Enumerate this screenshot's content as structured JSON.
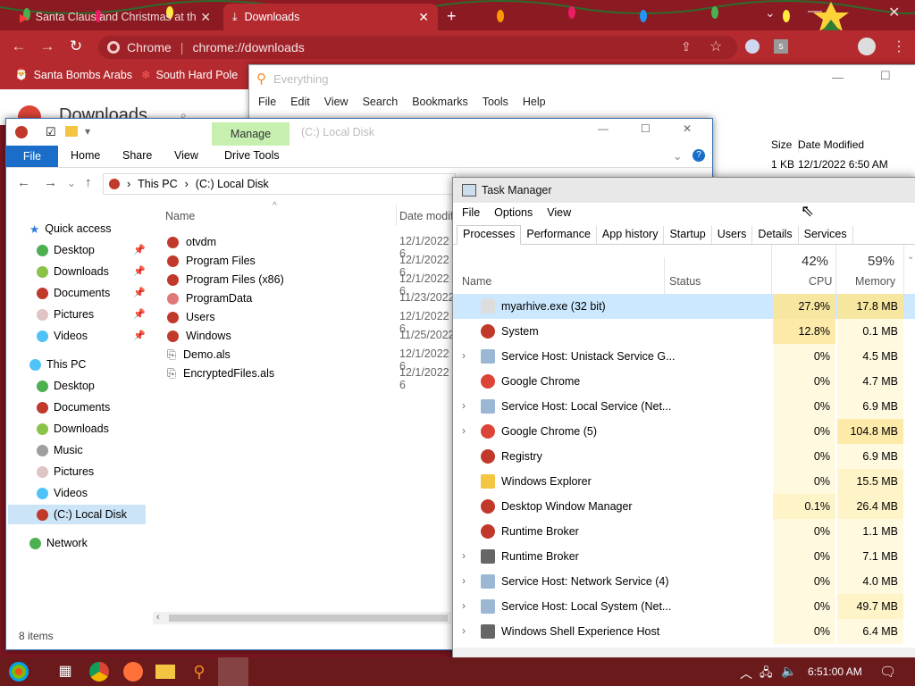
{
  "chrome": {
    "tabs": [
      {
        "title": "Santa Claus and Christmas at th",
        "active": false
      },
      {
        "title": "Downloads",
        "active": true
      }
    ],
    "new_tab": "+",
    "omnibox": {
      "site": "Chrome",
      "url": "chrome://downloads"
    },
    "bookmarks": [
      "Santa Bombs Arabs",
      "South Hard Pole"
    ],
    "page_title": "Downloads",
    "search_hint": "Search"
  },
  "everything": {
    "title": "Everything",
    "menu": [
      "File",
      "Edit",
      "View",
      "Search",
      "Bookmarks",
      "Tools",
      "Help"
    ],
    "columns": {
      "size": "Size",
      "date": "Date Modified"
    },
    "row": {
      "size": "1 KB",
      "date": "12/1/2022 6:50 AM"
    }
  },
  "explorer": {
    "title": "(C:) Local Disk",
    "ribbon": {
      "file": "File",
      "tabs": [
        "Home",
        "Share",
        "View"
      ],
      "manage": "Manage",
      "drive_tools": "Drive Tools"
    },
    "path": [
      "This PC",
      "(C:) Local Disk"
    ],
    "columns": {
      "name": "Name",
      "date": "Date modif"
    },
    "nav": [
      {
        "label": "Quick access",
        "level": 0,
        "icon": "star-icon"
      },
      {
        "label": "Desktop",
        "level": 1,
        "icon": "desktop-icon",
        "pinned": true
      },
      {
        "label": "Downloads",
        "level": 1,
        "icon": "downloads-icon",
        "pinned": true
      },
      {
        "label": "Documents",
        "level": 1,
        "icon": "documents-icon",
        "pinned": true
      },
      {
        "label": "Pictures",
        "level": 1,
        "icon": "pictures-icon",
        "pinned": true
      },
      {
        "label": "Videos",
        "level": 1,
        "icon": "videos-icon",
        "pinned": true
      },
      {
        "label": "This PC",
        "level": 0,
        "icon": "pc-icon"
      },
      {
        "label": "Desktop",
        "level": 1,
        "icon": "desktop-icon"
      },
      {
        "label": "Documents",
        "level": 1,
        "icon": "documents-icon"
      },
      {
        "label": "Downloads",
        "level": 1,
        "icon": "downloads-icon"
      },
      {
        "label": "Music",
        "level": 1,
        "icon": "music-icon"
      },
      {
        "label": "Pictures",
        "level": 1,
        "icon": "pictures-icon"
      },
      {
        "label": "Videos",
        "level": 1,
        "icon": "videos-icon"
      },
      {
        "label": "(C:) Local Disk",
        "level": 1,
        "icon": "disk-icon",
        "selected": true
      },
      {
        "label": "Network",
        "level": 0,
        "icon": "network-icon"
      }
    ],
    "files": [
      {
        "name": "otvdm",
        "date": "12/1/2022 6"
      },
      {
        "name": "Program Files",
        "date": "12/1/2022 6"
      },
      {
        "name": "Program Files (x86)",
        "date": "12/1/2022 6"
      },
      {
        "name": "ProgramData",
        "date": "11/23/2022"
      },
      {
        "name": "Users",
        "date": "12/1/2022 6"
      },
      {
        "name": "Windows",
        "date": "11/25/2022"
      },
      {
        "name": "Demo.als",
        "date": "12/1/2022 6"
      },
      {
        "name": "EncryptedFiles.als",
        "date": "12/1/2022 6"
      }
    ],
    "status": "8 items"
  },
  "taskmgr": {
    "title": "Task Manager",
    "menu": [
      "File",
      "Options",
      "View"
    ],
    "tabs": [
      "Processes",
      "Performance",
      "App history",
      "Startup",
      "Users",
      "Details",
      "Services"
    ],
    "header": {
      "name": "Name",
      "status": "Status",
      "cpu_pct": "42%",
      "cpu": "CPU",
      "mem_pct": "59%",
      "memory": "Memory"
    },
    "rows": [
      {
        "name": "myarhive.exe (32 bit)",
        "cpu": "27.9%",
        "mem": "17.8 MB",
        "expand": false,
        "selected": true,
        "icon": "app-icon"
      },
      {
        "name": "System",
        "cpu": "12.8%",
        "mem": "0.1 MB",
        "expand": false,
        "icon": "system-icon"
      },
      {
        "name": "Service Host: Unistack Service G...",
        "cpu": "0%",
        "mem": "4.5 MB",
        "expand": true,
        "icon": "gear-icon"
      },
      {
        "name": "Google Chrome",
        "cpu": "0%",
        "mem": "4.7 MB",
        "expand": false,
        "icon": "chrome-icon"
      },
      {
        "name": "Service Host: Local Service (Net...",
        "cpu": "0%",
        "mem": "6.9 MB",
        "expand": true,
        "icon": "gear-icon"
      },
      {
        "name": "Google Chrome (5)",
        "cpu": "0%",
        "mem": "104.8 MB",
        "expand": true,
        "icon": "chrome-icon"
      },
      {
        "name": "Registry",
        "cpu": "0%",
        "mem": "6.9 MB",
        "expand": false,
        "icon": "system-icon"
      },
      {
        "name": "Windows Explorer",
        "cpu": "0%",
        "mem": "15.5 MB",
        "expand": false,
        "icon": "folder-icon"
      },
      {
        "name": "Desktop Window Manager",
        "cpu": "0.1%",
        "mem": "26.4 MB",
        "expand": false,
        "icon": "system-icon"
      },
      {
        "name": "Runtime Broker",
        "cpu": "0%",
        "mem": "1.1 MB",
        "expand": false,
        "icon": "system-icon"
      },
      {
        "name": "Runtime Broker",
        "cpu": "0%",
        "mem": "7.1 MB",
        "expand": true,
        "icon": "window-icon"
      },
      {
        "name": "Service Host: Network Service (4)",
        "cpu": "0%",
        "mem": "4.0 MB",
        "expand": true,
        "icon": "gear-icon"
      },
      {
        "name": "Service Host: Local System (Net...",
        "cpu": "0%",
        "mem": "49.7 MB",
        "expand": true,
        "icon": "gear-icon"
      },
      {
        "name": "Windows Shell Experience Host",
        "cpu": "0%",
        "mem": "6.4 MB",
        "expand": true,
        "icon": "window-icon"
      }
    ]
  },
  "taskbar": {
    "clock": "6:51:00 AM"
  },
  "colors": {
    "chrome_dark": "#8b1a22",
    "chrome_mid": "#b42a2f",
    "explorer_blue": "#1a6ec9",
    "manage_green": "#c6efb0",
    "tm_selected": "#cce8ff"
  }
}
